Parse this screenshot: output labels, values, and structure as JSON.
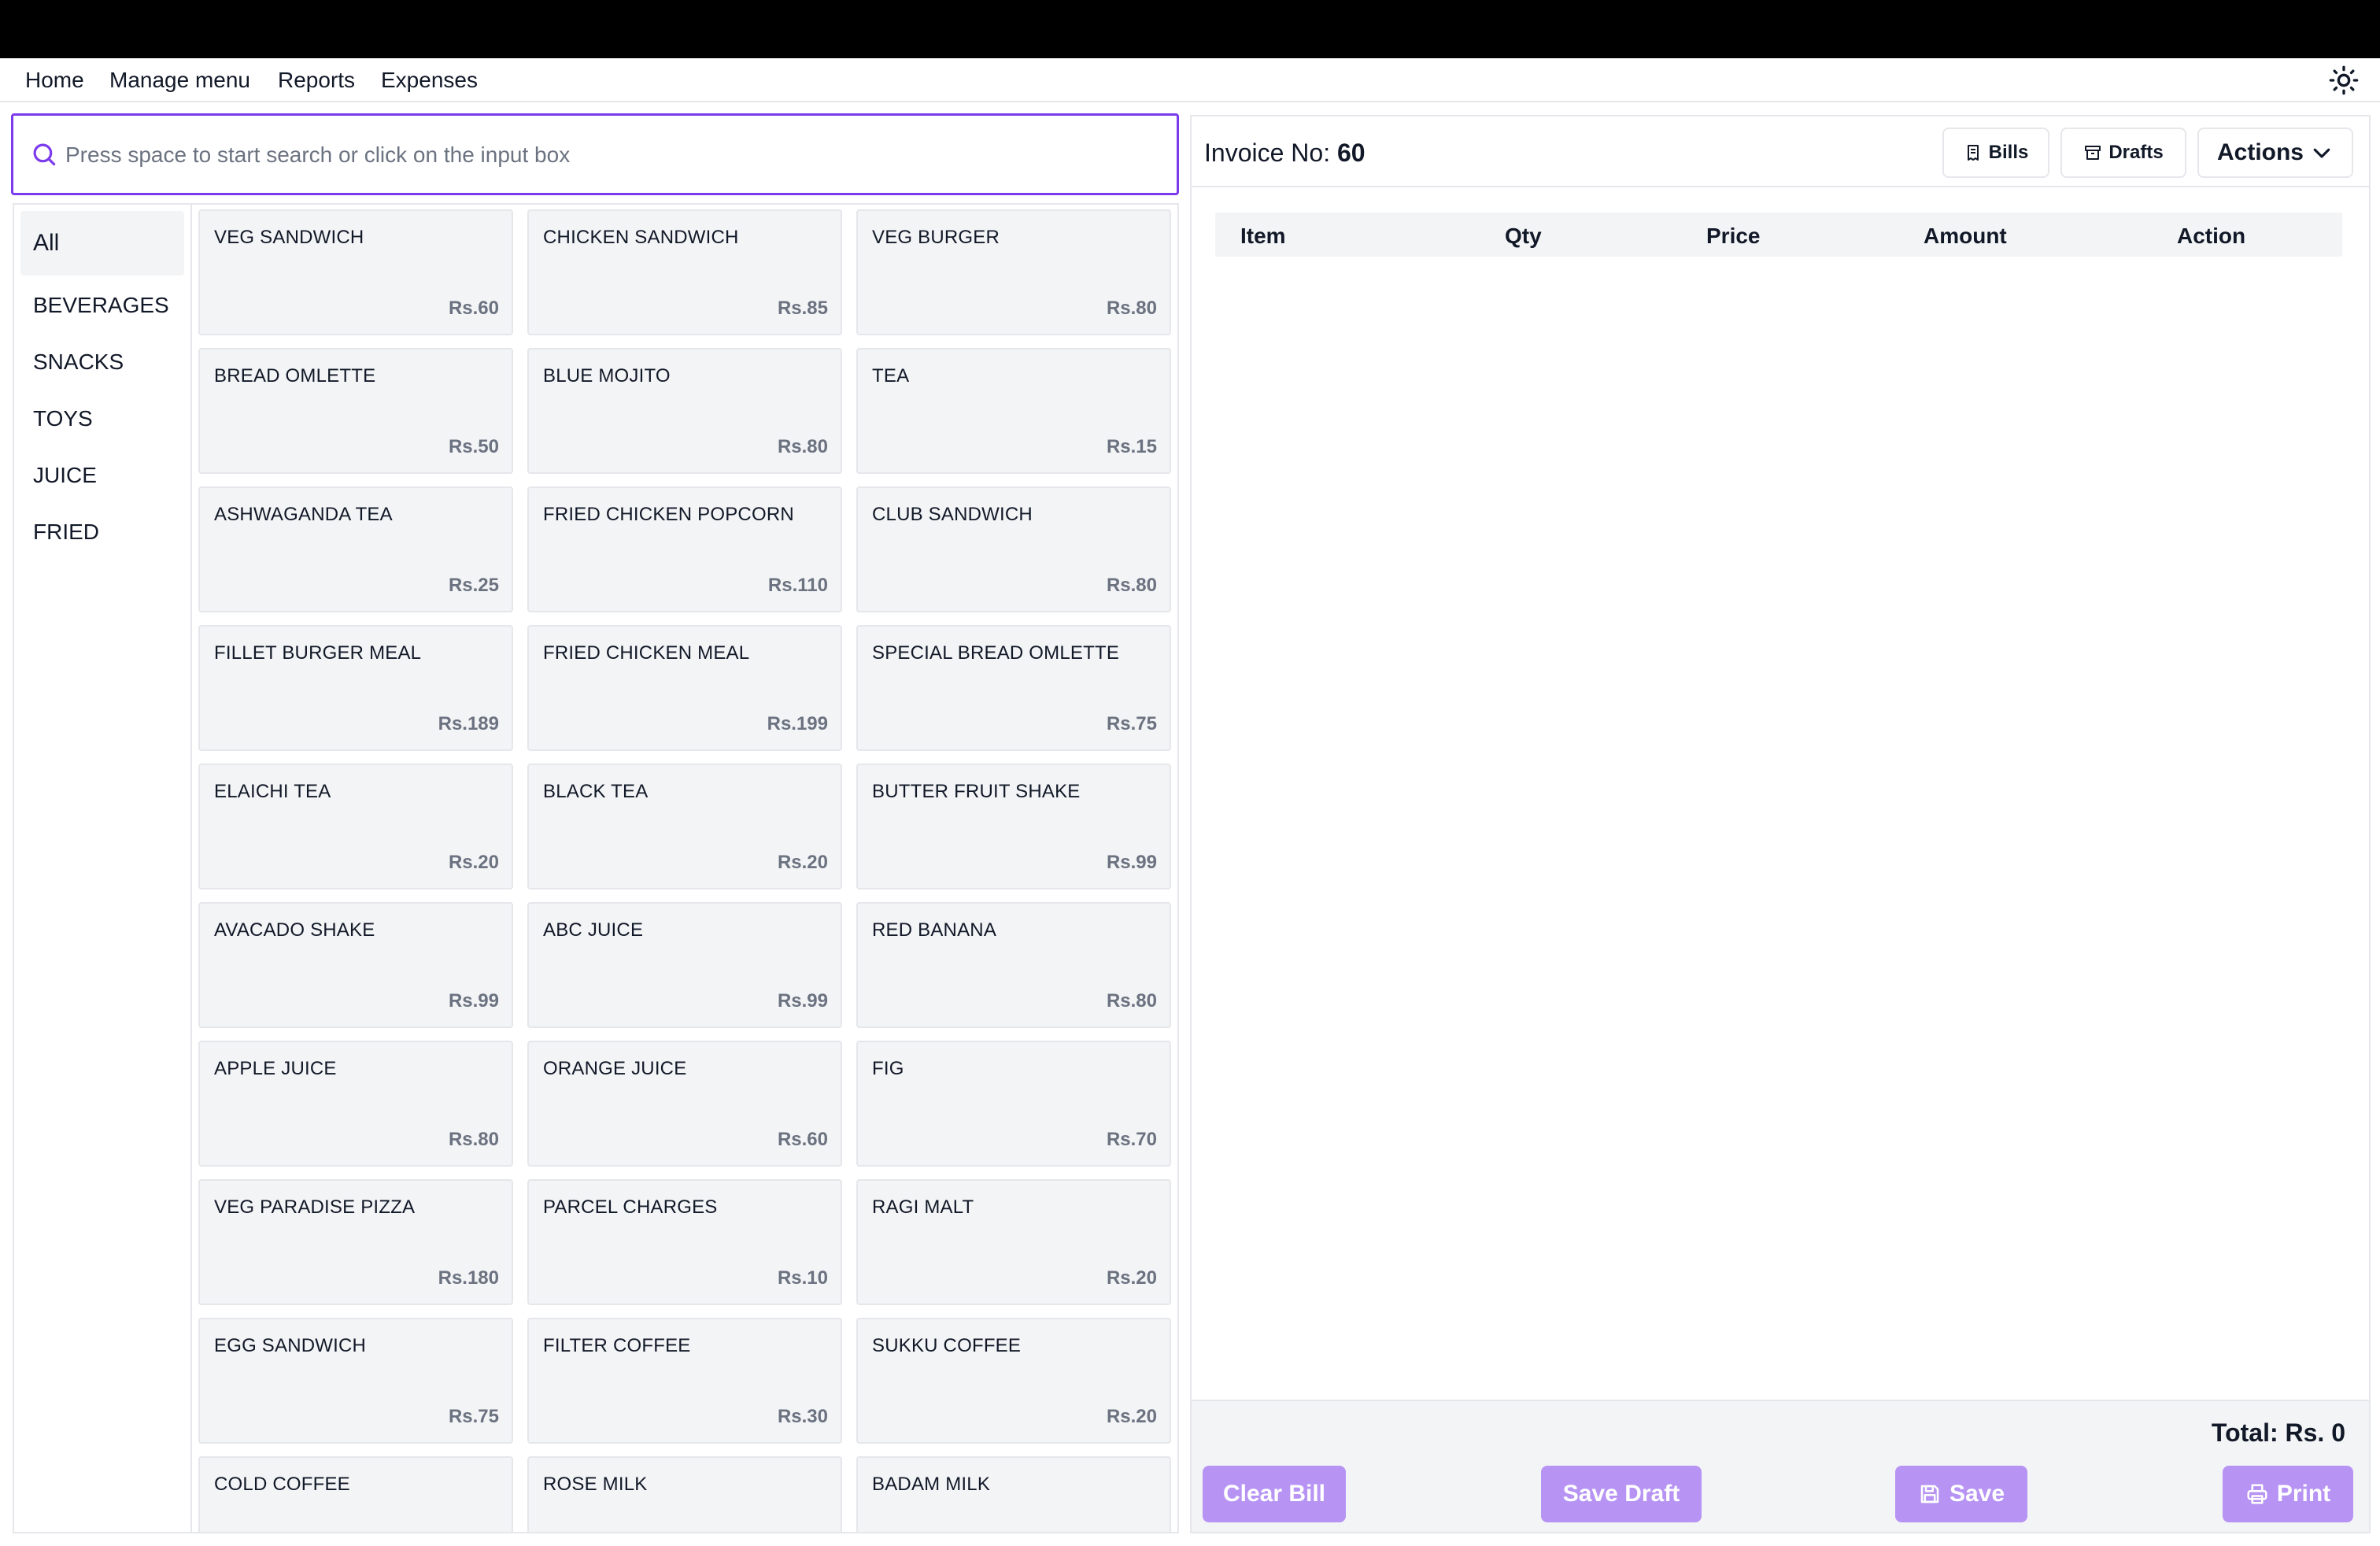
{
  "nav": {
    "items": [
      "Home",
      "Manage menu",
      "Reports",
      "Expenses"
    ],
    "theme_icon": "sun-icon"
  },
  "search": {
    "placeholder": "Press space to start search or click on the input box",
    "value": ""
  },
  "categories": [
    {
      "label": "All",
      "active": true
    },
    {
      "label": "BEVERAGES",
      "active": false
    },
    {
      "label": "SNACKS",
      "active": false
    },
    {
      "label": "TOYS",
      "active": false
    },
    {
      "label": "JUICE",
      "active": false
    },
    {
      "label": "FRIED",
      "active": false
    }
  ],
  "menu_items": [
    {
      "name": "VEG SANDWICH",
      "price": "Rs.60"
    },
    {
      "name": "CHICKEN SANDWICH",
      "price": "Rs.85"
    },
    {
      "name": "VEG BURGER",
      "price": "Rs.80"
    },
    {
      "name": "BREAD OMLETTE",
      "price": "Rs.50"
    },
    {
      "name": "BLUE MOJITO",
      "price": "Rs.80"
    },
    {
      "name": "TEA",
      "price": "Rs.15"
    },
    {
      "name": "ASHWAGANDA TEA",
      "price": "Rs.25"
    },
    {
      "name": "FRIED CHICKEN POPCORN",
      "price": "Rs.110"
    },
    {
      "name": "CLUB SANDWICH",
      "price": "Rs.80"
    },
    {
      "name": "FILLET BURGER MEAL",
      "price": "Rs.189"
    },
    {
      "name": "FRIED CHICKEN MEAL",
      "price": "Rs.199"
    },
    {
      "name": "SPECIAL BREAD OMLETTE",
      "price": "Rs.75"
    },
    {
      "name": "ELAICHI TEA",
      "price": "Rs.20"
    },
    {
      "name": "BLACK TEA",
      "price": "Rs.20"
    },
    {
      "name": "BUTTER FRUIT SHAKE",
      "price": "Rs.99"
    },
    {
      "name": "AVACADO SHAKE",
      "price": "Rs.99"
    },
    {
      "name": "ABC JUICE",
      "price": "Rs.99"
    },
    {
      "name": "RED BANANA",
      "price": "Rs.80"
    },
    {
      "name": "APPLE JUICE",
      "price": "Rs.80"
    },
    {
      "name": "ORANGE JUICE",
      "price": "Rs.60"
    },
    {
      "name": "FIG",
      "price": "Rs.70"
    },
    {
      "name": "VEG PARADISE PIZZA",
      "price": "Rs.180"
    },
    {
      "name": "PARCEL CHARGES",
      "price": "Rs.10"
    },
    {
      "name": "RAGI MALT",
      "price": "Rs.20"
    },
    {
      "name": "EGG SANDWICH",
      "price": "Rs.75"
    },
    {
      "name": "FILTER COFFEE",
      "price": "Rs.30"
    },
    {
      "name": "SUKKU COFFEE",
      "price": "Rs.20"
    },
    {
      "name": "COLD COFFEE",
      "price": ""
    },
    {
      "name": "ROSE MILK",
      "price": ""
    },
    {
      "name": "BADAM MILK",
      "price": ""
    }
  ],
  "invoice": {
    "label": "Invoice No:",
    "number": "60",
    "bills_label": "Bills",
    "drafts_label": "Drafts",
    "actions_label": "Actions",
    "columns": [
      "Item",
      "Qty",
      "Price",
      "Amount",
      "Action"
    ],
    "rows": [],
    "total_label": "Total: Rs. 0"
  },
  "footer_buttons": {
    "clear": "Clear Bill",
    "save_draft": "Save Draft",
    "save": "Save",
    "print": "Print"
  },
  "colors": {
    "accent": "#7c3aed",
    "button_purple": "#b794f4",
    "card_bg": "#f3f4f6",
    "price_text": "#6b7280"
  }
}
